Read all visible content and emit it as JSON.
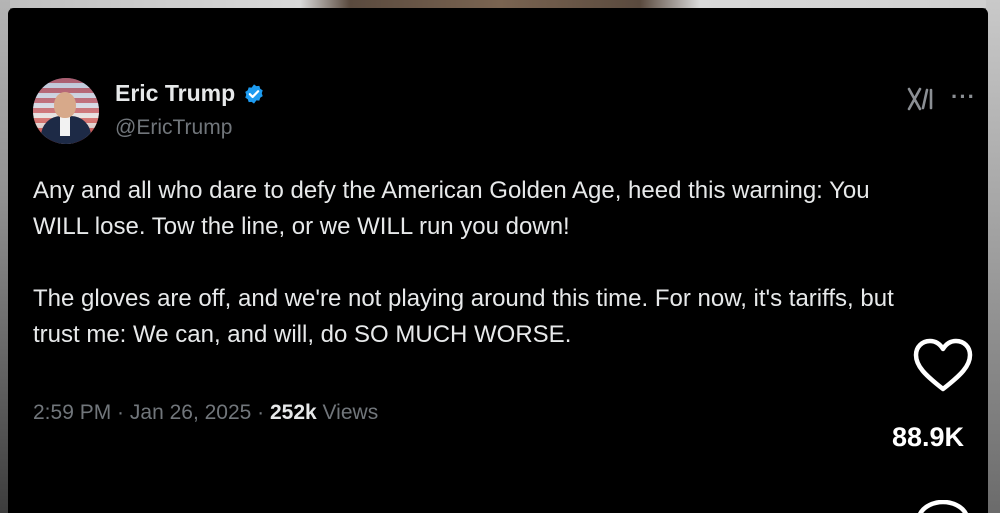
{
  "tweet": {
    "author": {
      "display_name": "Eric Trump",
      "handle": "@EricTrump",
      "verified_color": "#1d9bf0"
    },
    "paragraphs": [
      "Any and all who dare to defy the American Golden Age, heed this warning: You WILL lose. Tow the line, or we WILL run you down!",
      "The gloves are off, and we're not playing around this time. For now, it's tariffs, but trust me: We can, and will, do SO MUCH WORSE."
    ],
    "meta": {
      "time": "2:59 PM",
      "separator1": " · ",
      "date": "Jan 26, 2025",
      "separator2": " · ",
      "views_count": "252k",
      "views_label": " Views"
    },
    "icons": {
      "grok": "grok-icon",
      "more": "more-icon"
    }
  },
  "overlay": {
    "like_count": "88.9K",
    "icons": [
      "heart-icon",
      "comment-icon"
    ]
  },
  "colors": {
    "card_bg": "#000000",
    "text_primary": "#e7e9ea",
    "text_secondary": "#71767b",
    "accent": "#1d9bf0"
  }
}
